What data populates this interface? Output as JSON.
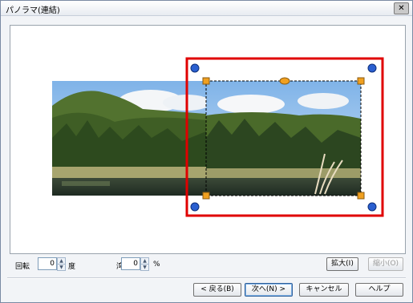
{
  "window": {
    "title": "パノラマ(連結)"
  },
  "titlebar": {
    "close_glyph": "✕"
  },
  "controls": {
    "rotation_label": "回転",
    "rotation_value": "0",
    "rotation_unit": "度",
    "distortion_label": "湾曲率",
    "distortion_value": "0",
    "distortion_unit": "%",
    "zoom_in_label": "拡大(I)",
    "zoom_out_label": "縮小(O)"
  },
  "footer": {
    "back_label": "< 戻る(B)",
    "next_label": "次へ(N) >",
    "cancel_label": "キャンセル",
    "help_label": "ヘルプ"
  },
  "colors": {
    "selection_frame": "#e00000",
    "corner_handle": "#f0a020",
    "rotate_handle": "#2a5fd0"
  },
  "icons": {
    "close": "close-icon",
    "spin_up": "up-arrow-icon",
    "spin_down": "down-arrow-icon",
    "rotate_handle": "rotate-handle-icon"
  }
}
